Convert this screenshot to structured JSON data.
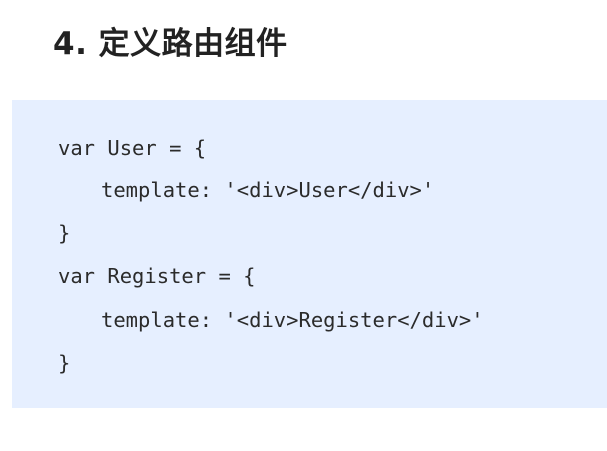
{
  "section": {
    "title": "4. 定义路由组件"
  },
  "code": {
    "lines": [
      "var User = {",
      "template: '<div>User</div>'",
      "}",
      "var Register = {",
      "template: '<div>Register</div>'",
      "}"
    ]
  }
}
